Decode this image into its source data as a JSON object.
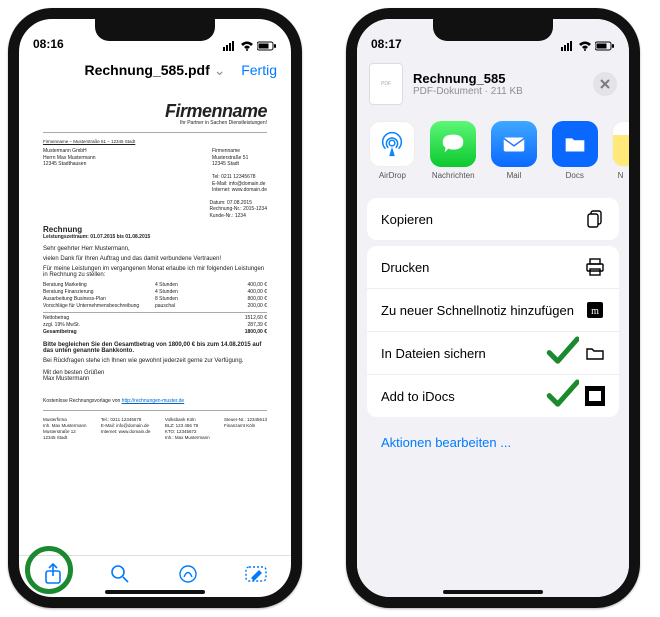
{
  "phone1": {
    "time": "08:16",
    "title": "Rechnung_585.pdf",
    "done": "Fertig",
    "doc": {
      "brand": "Firmenname",
      "tagline": "Ihr Partner in Sachen Dienstleistungen!",
      "topline": "Firmenname – Musterstraße 51 – 12345 Stadt",
      "addr_left": "Mustermann GmbH\nHerrn Max Mustermann\n12345 Stadthausen",
      "addr_right": "Firmenname\nMusterstraße 51\n12345 Stadt\n\nTel: 0211 12345678\nE-Mail: info@domain.de\nInternet: www.domain.de",
      "dates": "Datum: 07.08.2015\nRechnung-Nr.: 2015-1234\nKunde-Nr.: 1234",
      "h2": "Rechnung",
      "period": "Leistungszeitraum: 01.07.2015 bis 01.08.2015",
      "greet": "Sehr geehrter Herr Mustermann,",
      "p1": "vielen Dank für Ihren Auftrag und das damit verbundene Vertrauen!",
      "p2": "Für meine Leistungen im vergangenen Monat erlaube ich mir folgenden Leistungen in Rechnung zu stellen:",
      "items": [
        {
          "a": "Beratung Marketing",
          "b": "4 Stunden",
          "c": "400,00 €"
        },
        {
          "a": "Beratung Finanzierung",
          "b": "4 Stunden",
          "c": "400,00 €"
        },
        {
          "a": "Ausarbeitung Business-Plan",
          "b": "8 Stunden",
          "c": "800,00 €"
        },
        {
          "a": "Vorschläge für Unternehmensbeschreibung",
          "b": "pauschal",
          "c": "200,00 €"
        }
      ],
      "net_l": "Nettobetrag",
      "net_r": "1512,60 €",
      "vat_l": "zzgl. 19% MwSt.",
      "vat_r": "287,39 €",
      "tot_l": "Gesamtbetrag",
      "tot_r": "1800,00 €",
      "pay": "Bitte begleichen Sie den Gesamtbetrag von 1800,00 € bis zum 14.08.2015 auf das unten genannte Bankkonto.",
      "p3": "Bei Rückfragen stehe ich Ihnen wie gewohnt jederzeit gerne zur Verfügung.",
      "sign": "Mit den besten Grüßen\nMax Mustermann",
      "footer_note": "Kostenlose Rechnungsvorlage von ",
      "footer_link": "http://rechnungen-muster.de",
      "foot_l": "Musterfirma\nInh. Max Mustermann\nMusterstraße 12\n12345 Stadt",
      "foot_m1": "Tel.: 0211 12345678\nE-Mail: info@domain.de\nInternet: www.domain.de",
      "foot_m2": "Volksbank Köln\nBLZ: 123 456 78\nKTO: 12345672\nInh.: Max Mustermann",
      "foot_r": "Steuer-Nr.: 12345613\nFinanzamt Köln"
    }
  },
  "phone2": {
    "time": "08:17",
    "sheet_title": "Rechnung_585",
    "sheet_sub": "PDF-Dokument · 211 KB",
    "apps": {
      "airdrop": "AirDrop",
      "messages": "Nachrichten",
      "mail": "Mail",
      "docs": "Docs",
      "notes": "N"
    },
    "actions": {
      "copy": "Kopieren",
      "print": "Drucken",
      "quicknote": "Zu neuer Schnellnotiz hinzufügen",
      "files": "In Dateien sichern",
      "idocs": "Add to iDocs"
    },
    "edit": "Aktionen bearbeiten ..."
  }
}
